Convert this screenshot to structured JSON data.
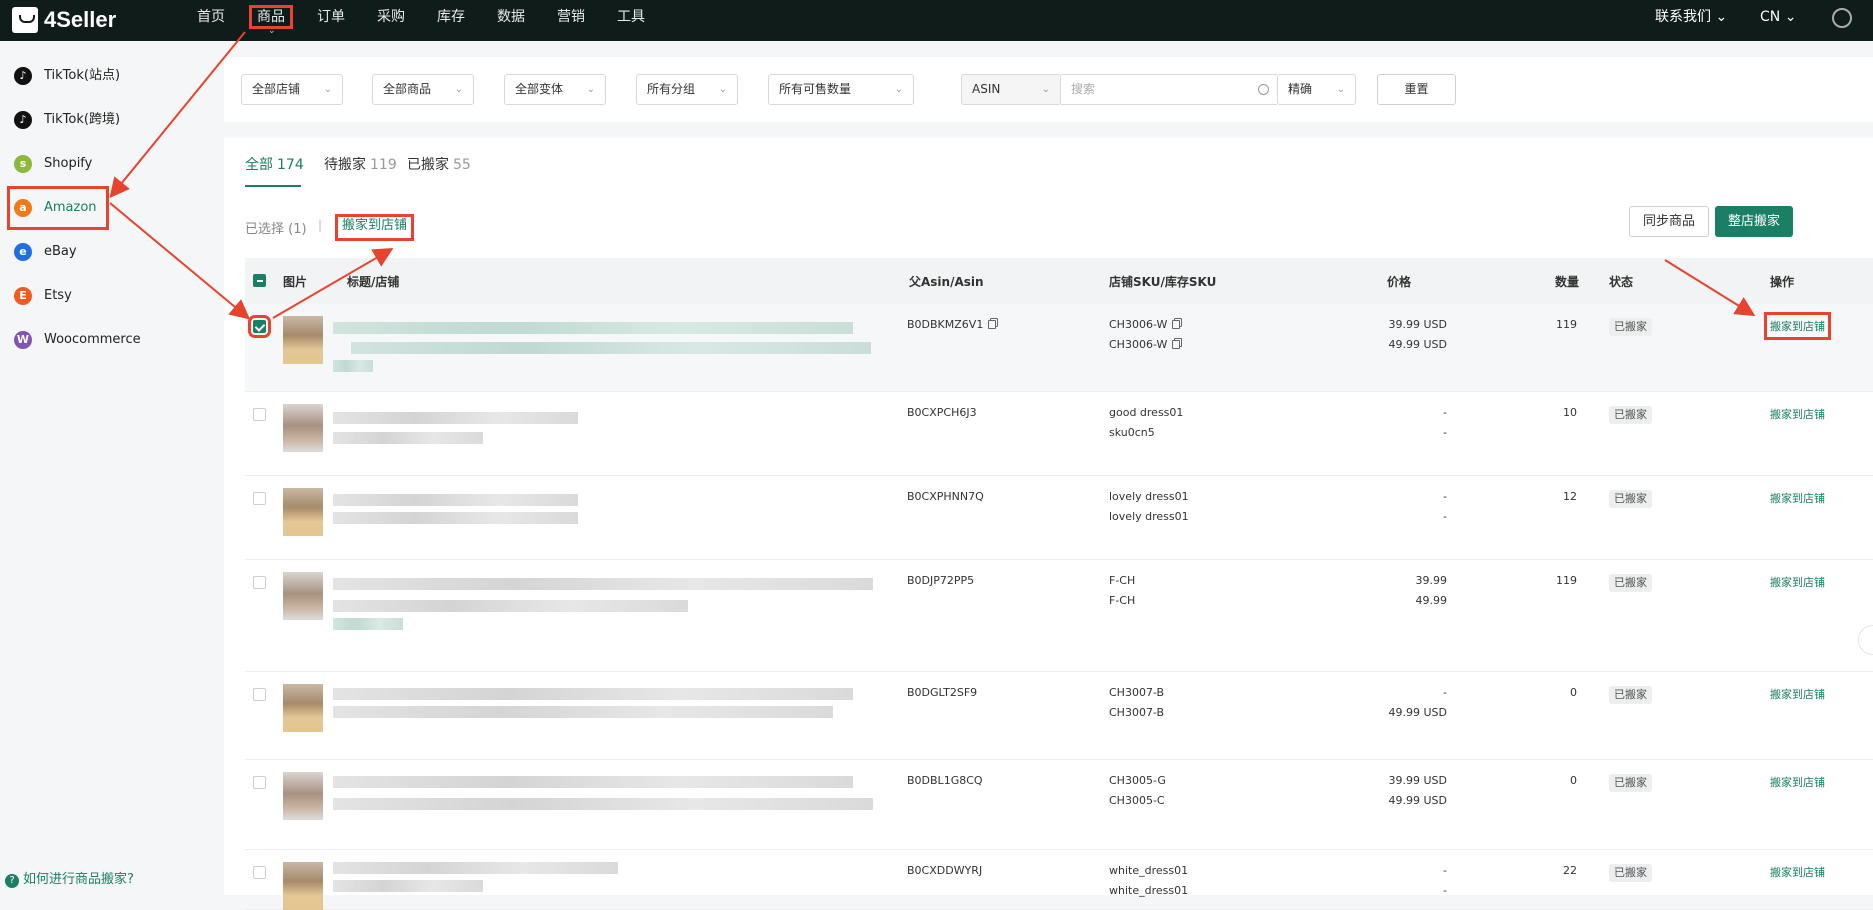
{
  "topbar": {
    "logo": "4Seller",
    "nav": [
      "首页",
      "商品",
      "订单",
      "采购",
      "库存",
      "数据",
      "营销",
      "工具"
    ],
    "contact": "联系我们",
    "lang": "CN"
  },
  "sidebar": {
    "items": [
      {
        "label": "TikTok(站点)",
        "icon": "tiktok-icon"
      },
      {
        "label": "TikTok(跨境)",
        "icon": "tiktok-icon"
      },
      {
        "label": "Shopify",
        "icon": "shopify-icon"
      },
      {
        "label": "Amazon",
        "icon": "amazon-icon"
      },
      {
        "label": "eBay",
        "icon": "ebay-icon"
      },
      {
        "label": "Etsy",
        "icon": "etsy-icon"
      },
      {
        "label": "Woocommerce",
        "icon": "woocommerce-icon"
      }
    ],
    "help": "如何进行商品搬家?"
  },
  "filters": {
    "store": "全部店铺",
    "product": "全部商品",
    "variant": "全部变体",
    "group": "所有分组",
    "qty": "所有可售数量",
    "field": "ASIN",
    "search_placeholder": "搜索",
    "match": "精确",
    "reset": "重置"
  },
  "tabs": [
    {
      "label": "全部",
      "count": "174"
    },
    {
      "label": "待搬家",
      "count": "119"
    },
    {
      "label": "已搬家",
      "count": "55"
    }
  ],
  "toolbar": {
    "selected": "已选择 (1)",
    "bulk_move": "搬家到店铺",
    "sync": "同步商品",
    "whole_move": "整店搬家"
  },
  "table": {
    "headers": {
      "image": "图片",
      "title": "标题/店铺",
      "asin": "父Asin/Asin",
      "sku": "店铺SKU/库存SKU",
      "price": "价格",
      "qty": "数量",
      "status": "状态",
      "action": "操作"
    },
    "rows": [
      {
        "asin": "B0DBKMZ6V1",
        "sku1": "CH3006-W",
        "sku2": "CH3006-W",
        "price1": "39.99 USD",
        "price2": "49.99 USD",
        "qty": "119",
        "status": "已搬家",
        "action": "搬家到店铺"
      },
      {
        "asin": "B0CXPCH6J3",
        "sku1": "good dress01",
        "sku2": "sku0cn5",
        "price1": "-",
        "price2": "-",
        "qty": "10",
        "status": "已搬家",
        "action": "搬家到店铺"
      },
      {
        "asin": "B0CXPHNN7Q",
        "sku1": "lovely dress01",
        "sku2": "lovely dress01",
        "price1": "-",
        "price2": "-",
        "qty": "12",
        "status": "已搬家",
        "action": "搬家到店铺"
      },
      {
        "asin": "B0DJP72PP5",
        "sku1": "F-CH",
        "sku2": "F-CH",
        "price1": "39.99",
        "price2": "49.99",
        "qty": "119",
        "status": "已搬家",
        "action": "搬家到店铺"
      },
      {
        "asin": "B0DGLT2SF9",
        "sku1": "CH3007-B",
        "sku2": "CH3007-B",
        "price1": "-",
        "price2": "49.99 USD",
        "qty": "0",
        "status": "已搬家",
        "action": "搬家到店铺"
      },
      {
        "asin": "B0DBL1G8CQ",
        "sku1": "CH3005-G",
        "sku2": "CH3005-C",
        "price1": "39.99 USD",
        "price2": "49.99 USD",
        "qty": "0",
        "status": "已搬家",
        "action": "搬家到店铺"
      },
      {
        "asin": "B0CXDDWYRJ",
        "sku1": "white_dress01",
        "sku2": "white_dress01",
        "price1": "-",
        "price2": "-",
        "qty": "22",
        "status": "已搬家",
        "action": "搬家到店铺"
      }
    ]
  },
  "colors": {
    "accent": "#1a7f64",
    "annotation": "#e8432f",
    "topbar": "#101c1a"
  }
}
